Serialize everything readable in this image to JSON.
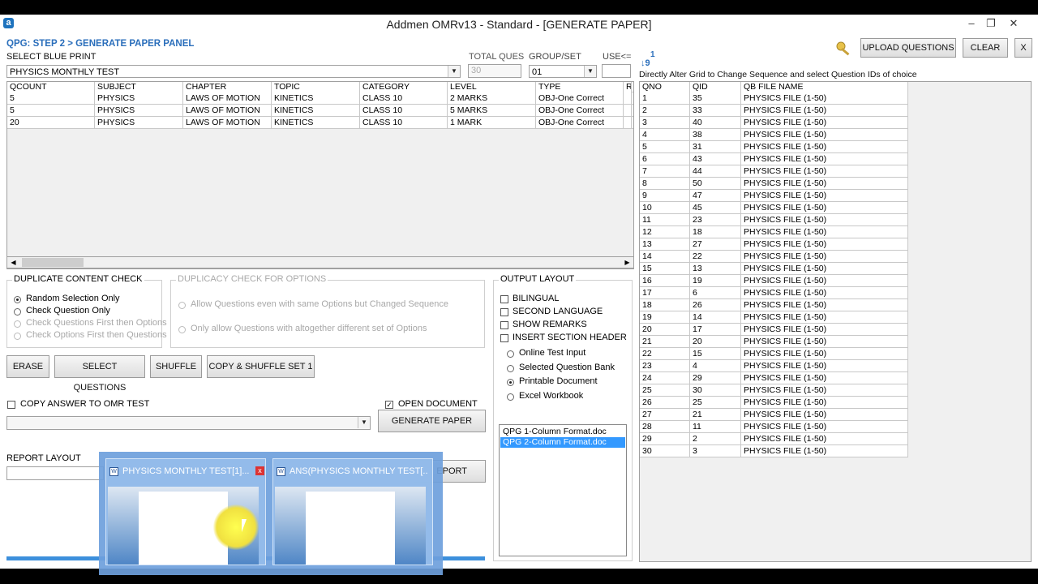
{
  "window": {
    "title": "Addmen OMRv13 - Standard - [GENERATE PAPER]",
    "app_icon": "a",
    "minimize_glyph": "–",
    "restore_glyph": "❐",
    "close_glyph": "✕"
  },
  "header": {
    "panel_title": "QPG: STEP 2 > GENERATE PAPER PANEL",
    "select_blueprint_label": "SELECT BLUE PRINT",
    "blueprint_value": "PHYSICS MONTHLY TEST",
    "total_ques_label": "TOTAL QUES",
    "total_ques_value": "30",
    "group_set_label": "GROUP/SET",
    "group_set_value": "01",
    "use_label": "USE<=",
    "use_value": ""
  },
  "toolbar": {
    "upload_label": "UPLOAD QUESTIONS",
    "clear_label": "CLEAR",
    "close_label": "X"
  },
  "sort_hint": {
    "icon_top": "1",
    "icon_bottom": "↓9",
    "text": "Directly Alter Grid to Change Sequence and select Question IDs of choice"
  },
  "blueprint_grid": {
    "columns": [
      "QCOUNT",
      "SUBJECT",
      "CHAPTER",
      "TOPIC",
      "CATEGORY",
      "LEVEL",
      "TYPE",
      "R"
    ],
    "rows": [
      [
        "5",
        "PHYSICS",
        "LAWS OF MOTION",
        "KINETICS",
        "CLASS 10",
        "2 MARKS",
        "OBJ-One Correct",
        ""
      ],
      [
        "5",
        "PHYSICS",
        "LAWS OF MOTION",
        "KINETICS",
        "CLASS 10",
        "5 MARKS",
        "OBJ-One Correct",
        ""
      ],
      [
        "20",
        "PHYSICS",
        "LAWS OF MOTION",
        "KINETICS",
        "CLASS 10",
        "1 MARK",
        "OBJ-One Correct",
        ""
      ]
    ]
  },
  "duplicate_check": {
    "title": "DUPLICATE CONTENT CHECK",
    "options": [
      {
        "label": "Random Selection Only",
        "selected": true,
        "enabled": true
      },
      {
        "label": "Check Question Only",
        "selected": false,
        "enabled": true
      },
      {
        "label": "Check Questions First then Options",
        "selected": false,
        "enabled": false
      },
      {
        "label": "Check Options First then Questions",
        "selected": false,
        "enabled": false
      }
    ]
  },
  "duplicacy_options": {
    "title": "DUPLICACY CHECK FOR OPTIONS",
    "options": [
      {
        "label": "Allow Questions even with same Options but Changed Sequence"
      },
      {
        "label": "Only allow Questions with altogether different set of Options"
      }
    ]
  },
  "actions": {
    "erase": "ERASE",
    "select_questions": "SELECT QUESTIONS",
    "shuffle": "SHUFFLE",
    "copy_shuffle": "COPY & SHUFFLE  SET 1"
  },
  "omr": {
    "copy_answer_label": "COPY ANSWER TO OMR TEST",
    "copy_answer_checked": false,
    "open_document_label": "OPEN DOCUMENT",
    "open_document_checked": true,
    "generate_paper_label": "GENERATE PAPER",
    "report_layout_label": "REPORT LAYOUT",
    "report_button_partial": "EPORT"
  },
  "output_layout": {
    "title": "OUTPUT LAYOUT",
    "checkboxes": [
      "BILINGUAL",
      "SECOND LANGUAGE",
      "SHOW REMARKS",
      "INSERT SECTION HEADER"
    ],
    "radios": [
      {
        "label": "Online Test Input",
        "selected": false
      },
      {
        "label": "Selected Question Bank",
        "selected": false
      },
      {
        "label": "Printable Document",
        "selected": true
      },
      {
        "label": "Excel Workbook",
        "selected": false
      }
    ],
    "formats": [
      {
        "label": "QPG 1-Column Format.doc",
        "selected": false
      },
      {
        "label": "QPG 2-Column Format.doc",
        "selected": true
      }
    ]
  },
  "question_grid": {
    "columns": [
      "QNO",
      "QID",
      "QB FILE NAME"
    ],
    "rows": [
      [
        "1",
        "35",
        "PHYSICS FILE (1-50)"
      ],
      [
        "2",
        "33",
        "PHYSICS FILE (1-50)"
      ],
      [
        "3",
        "40",
        "PHYSICS FILE (1-50)"
      ],
      [
        "4",
        "38",
        "PHYSICS FILE (1-50)"
      ],
      [
        "5",
        "31",
        "PHYSICS FILE (1-50)"
      ],
      [
        "6",
        "43",
        "PHYSICS FILE (1-50)"
      ],
      [
        "7",
        "44",
        "PHYSICS FILE (1-50)"
      ],
      [
        "8",
        "50",
        "PHYSICS FILE (1-50)"
      ],
      [
        "9",
        "47",
        "PHYSICS FILE (1-50)"
      ],
      [
        "10",
        "45",
        "PHYSICS FILE (1-50)"
      ],
      [
        "11",
        "23",
        "PHYSICS FILE (1-50)"
      ],
      [
        "12",
        "18",
        "PHYSICS FILE (1-50)"
      ],
      [
        "13",
        "27",
        "PHYSICS FILE (1-50)"
      ],
      [
        "14",
        "22",
        "PHYSICS FILE (1-50)"
      ],
      [
        "15",
        "13",
        "PHYSICS FILE (1-50)"
      ],
      [
        "16",
        "19",
        "PHYSICS FILE (1-50)"
      ],
      [
        "17",
        "6",
        "PHYSICS FILE (1-50)"
      ],
      [
        "18",
        "26",
        "PHYSICS FILE (1-50)"
      ],
      [
        "19",
        "14",
        "PHYSICS FILE (1-50)"
      ],
      [
        "20",
        "17",
        "PHYSICS FILE (1-50)"
      ],
      [
        "21",
        "20",
        "PHYSICS FILE (1-50)"
      ],
      [
        "22",
        "15",
        "PHYSICS FILE (1-50)"
      ],
      [
        "23",
        "4",
        "PHYSICS FILE (1-50)"
      ],
      [
        "24",
        "29",
        "PHYSICS FILE (1-50)"
      ],
      [
        "25",
        "30",
        "PHYSICS FILE (1-50)"
      ],
      [
        "26",
        "25",
        "PHYSICS FILE (1-50)"
      ],
      [
        "27",
        "21",
        "PHYSICS FILE (1-50)"
      ],
      [
        "28",
        "11",
        "PHYSICS FILE (1-50)"
      ],
      [
        "29",
        "2",
        "PHYSICS FILE (1-50)"
      ],
      [
        "30",
        "3",
        "PHYSICS FILE (1-50)"
      ]
    ]
  },
  "taskbar_preview": {
    "items": [
      {
        "title": "PHYSICS MONTHLY TEST[1]...",
        "close": "x"
      },
      {
        "title": "ANS(PHYSICS MONTHLY TEST[..."
      }
    ]
  },
  "colors": {
    "accent_blue": "#2a6ebb",
    "selection": "#3399ff",
    "taskbar_popup": "#6ea0dc"
  }
}
